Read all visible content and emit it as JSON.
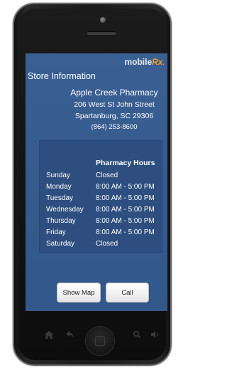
{
  "app": {
    "brand_main": "mobile",
    "brand_accent": "Rx",
    "brand_dot": "."
  },
  "store_info": {
    "heading": "Store Information",
    "name": "Apple Creek Pharmacy",
    "address_line1": "206 West St John Street",
    "address_line2": "Spartanburg, SC 29306",
    "phone": "(864) 253-8600"
  },
  "hours": {
    "title": "Pharmacy Hours",
    "rows": [
      {
        "day": "Sunday",
        "time": "Closed"
      },
      {
        "day": "Monday",
        "time": "8:00 AM - 5:00 PM"
      },
      {
        "day": "Tuesday",
        "time": "8:00 AM - 5:00 PM"
      },
      {
        "day": "Wednesday",
        "time": "8:00 AM - 5:00 PM"
      },
      {
        "day": "Thursday",
        "time": "8:00 AM - 5:00 PM"
      },
      {
        "day": "Friday",
        "time": "8:00 AM - 5:00 PM"
      },
      {
        "day": "Saturday",
        "time": "Closed"
      }
    ]
  },
  "actions": {
    "show_map_label": "Show Map",
    "call_label": "Call"
  },
  "device_nav": {
    "icons": [
      "home-icon",
      "back-icon",
      "search-icon",
      "volume-icon"
    ]
  },
  "colors": {
    "screen_bg": "#3a5f92",
    "panel_bg": "#2d4e7f",
    "brand_accent": "#f39b2a"
  }
}
